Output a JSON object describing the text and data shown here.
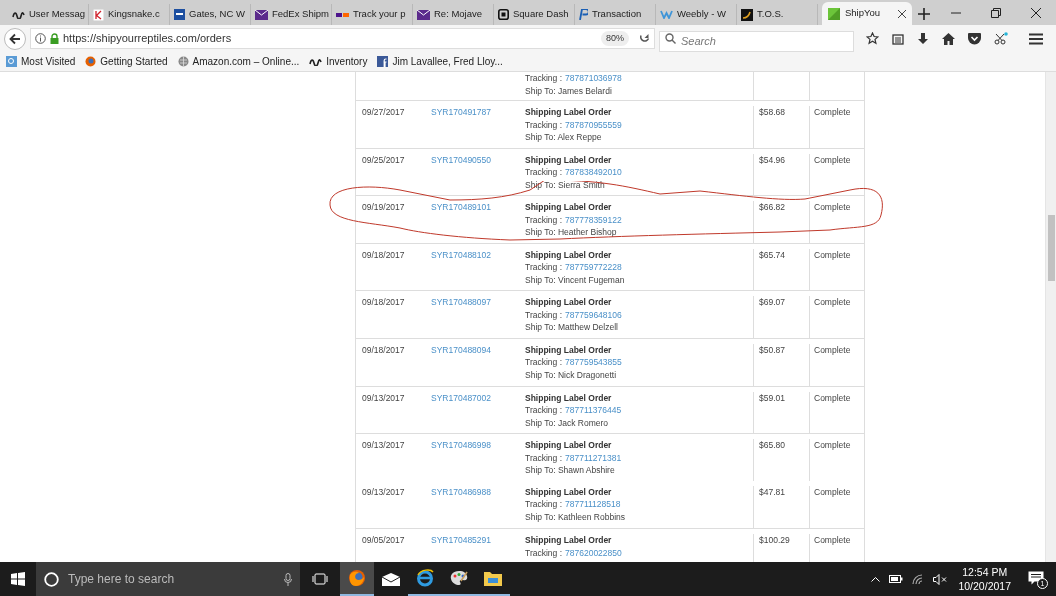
{
  "browser": {
    "tabs": [
      {
        "title": "User Messag",
        "selected": false
      },
      {
        "title": "Kingsnake.c",
        "selected": false
      },
      {
        "title": "Gates, NC W",
        "selected": false
      },
      {
        "title": "FedEx Shipm",
        "selected": false
      },
      {
        "title": "Track your p",
        "selected": false
      },
      {
        "title": "Re: Mojave",
        "selected": false
      },
      {
        "title": "Square Dash",
        "selected": false
      },
      {
        "title": "Transaction",
        "selected": false
      },
      {
        "title": "Weebly - W",
        "selected": false
      },
      {
        "title": "T.O.S.",
        "selected": false
      },
      {
        "title": "ShipYou",
        "selected": true
      }
    ],
    "url": "https://shipyourreptiles.com/orders",
    "zoom": "80%",
    "search_placeholder": "Search",
    "bookmarks": [
      "Most Visited",
      "Getting Started",
      "Amazon.com – Online...",
      "Inventory",
      "Jim Lavallee, Fred Lloy..."
    ]
  },
  "orders": {
    "rows": [
      {
        "kind": "partial",
        "separated": false,
        "tracking_label": "Tracking :",
        "tracking": "787871036978",
        "ship_to": "Ship To: James Belardi"
      },
      {
        "kind": "full",
        "separated": true,
        "date": "09/27/2017",
        "order": "SYR170491787",
        "description": "Shipping Label Order",
        "tracking_label": "Tracking :",
        "tracking": "787870955559",
        "ship_to": "Ship To: Alex Reppe",
        "amount": "$58.68",
        "status": "Complete"
      },
      {
        "kind": "full",
        "separated": true,
        "date": "09/25/2017",
        "order": "SYR170490550",
        "description": "Shipping Label Order",
        "tracking_label": "Tracking :",
        "tracking": "787838492010",
        "ship_to": "Ship To: Sierra Smith",
        "amount": "$54.96",
        "status": "Complete"
      },
      {
        "kind": "full",
        "separated": true,
        "date": "09/19/2017",
        "order": "SYR170489101",
        "description": "Shipping Label Order",
        "tracking_label": "Tracking :",
        "tracking": "787778359122",
        "ship_to": "Ship To: Heather Bishop",
        "amount": "$66.82",
        "status": "Complete"
      },
      {
        "kind": "full",
        "separated": true,
        "date": "09/18/2017",
        "order": "SYR170488102",
        "description": "Shipping Label Order",
        "tracking_label": "Tracking :",
        "tracking": "787759772228",
        "ship_to": "Ship To: Vincent Fugeman",
        "amount": "$65.74",
        "status": "Complete"
      },
      {
        "kind": "full",
        "separated": true,
        "date": "09/18/2017",
        "order": "SYR170488097",
        "description": "Shipping Label Order",
        "tracking_label": "Tracking :",
        "tracking": "787759648106",
        "ship_to": "Ship To: Matthew Delzell",
        "amount": "$69.07",
        "status": "Complete"
      },
      {
        "kind": "full",
        "separated": true,
        "date": "09/18/2017",
        "order": "SYR170488094",
        "description": "Shipping Label Order",
        "tracking_label": "Tracking :",
        "tracking": "787759543855",
        "ship_to": "Ship To: Nick Dragonetti",
        "amount": "$50.87",
        "status": "Complete"
      },
      {
        "kind": "full",
        "separated": true,
        "date": "09/13/2017",
        "order": "SYR170487002",
        "description": "Shipping Label Order",
        "tracking_label": "Tracking :",
        "tracking": "787711376445",
        "ship_to": "Ship To: Jack Romero",
        "amount": "$59.01",
        "status": "Complete"
      },
      {
        "kind": "full",
        "separated": true,
        "date": "09/13/2017",
        "order": "SYR170486998",
        "description": "Shipping Label Order",
        "tracking_label": "Tracking :",
        "tracking": "787711271381",
        "ship_to": "Ship To: Shawn Abshire",
        "amount": "$65.80",
        "status": "Complete"
      },
      {
        "kind": "full",
        "separated": false,
        "date": "09/13/2017",
        "order": "SYR170486988",
        "description": "Shipping Label Order",
        "tracking_label": "Tracking :",
        "tracking": "787711128518",
        "ship_to": "Ship To: Kathleen Robbins",
        "amount": "$47.81",
        "status": "Complete"
      },
      {
        "kind": "full",
        "separated": true,
        "date": "09/05/2017",
        "order": "SYR170485291",
        "description": "Shipping Label Order",
        "tracking_label": "Tracking :",
        "tracking": "787620022850",
        "amount": "$100.29",
        "status": "Complete"
      }
    ]
  },
  "taskbar": {
    "search_placeholder": "Type here to search",
    "time": "12:54 PM",
    "date": "10/20/2017",
    "notification_count": "1"
  }
}
